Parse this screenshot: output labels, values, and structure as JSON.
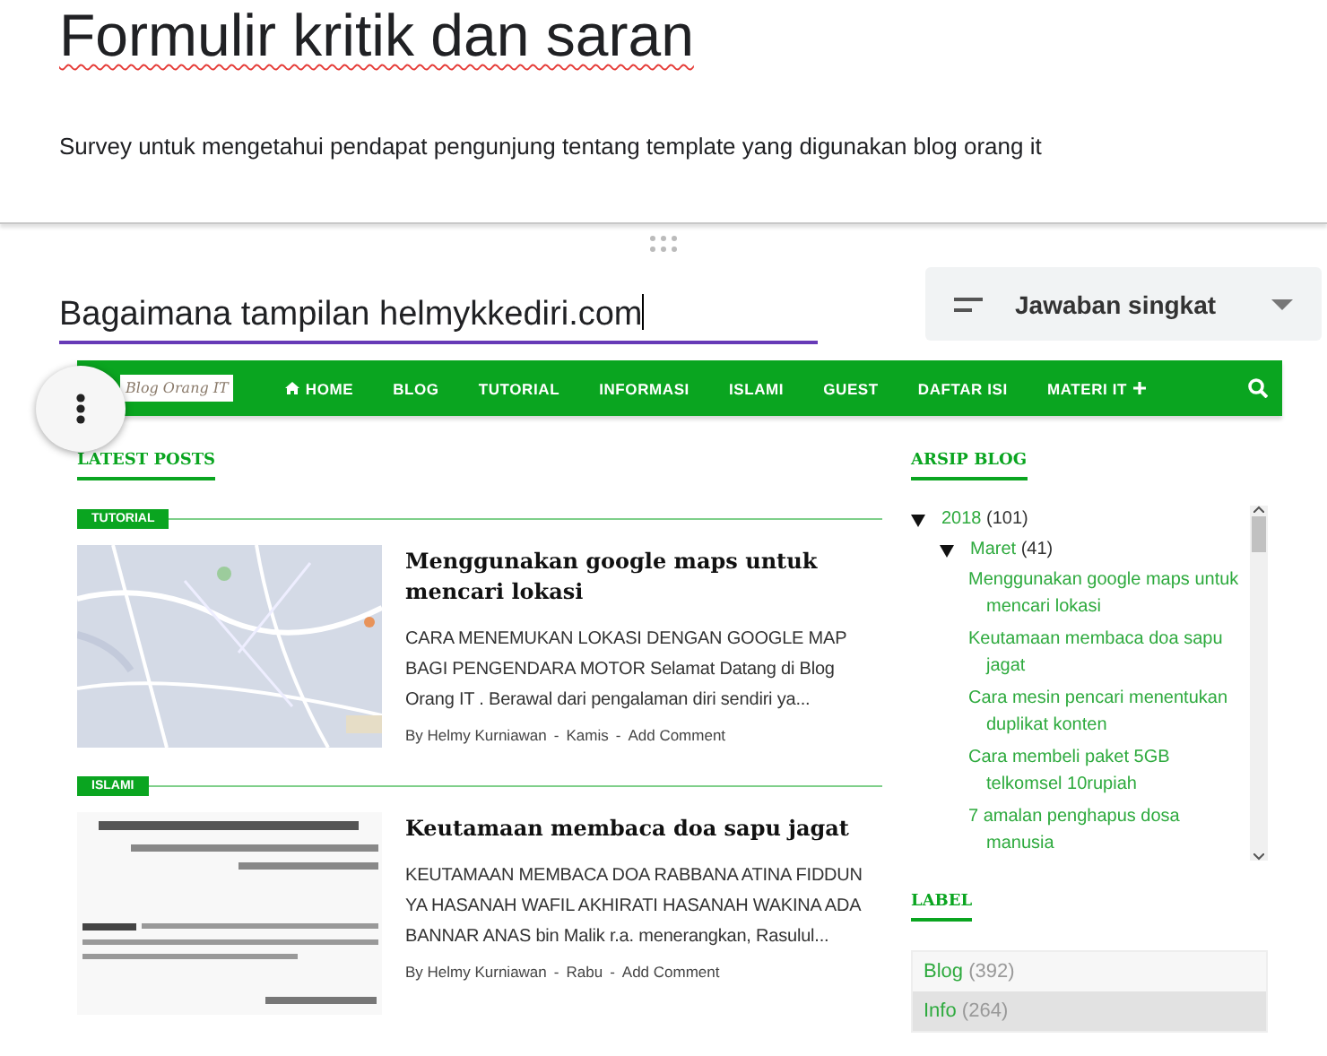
{
  "form": {
    "title": "Formulir kritik dan saran",
    "description": "Survey untuk mengetahui pendapat pengunjung tentang template yang digunakan blog orang it"
  },
  "question": {
    "title": "Bagaimana tampilan helmykkediri.com",
    "type": "Jawaban singkat"
  },
  "blog": {
    "logo": "Blog Orang IT",
    "nav": [
      {
        "label": "HOME",
        "kind": "home"
      },
      {
        "label": "BLOG",
        "kind": "plain"
      },
      {
        "label": "TUTORIAL",
        "kind": "plain"
      },
      {
        "label": "INFORMASI",
        "kind": "plain"
      },
      {
        "label": "ISLAMI",
        "kind": "plain"
      },
      {
        "label": "GUEST",
        "kind": "plain"
      },
      {
        "label": "DAFTAR ISI",
        "kind": "plain"
      },
      {
        "label": "MATERI IT",
        "kind": "more"
      }
    ],
    "latest_heading": "LATEST POSTS",
    "posts": [
      {
        "category": "TUTORIAL",
        "title": "Menggunakan google maps untuk mencari lokasi",
        "excerpt": "CARA MENEMUKAN LOKASI DENGAN GOOGLE MAP BAGI PENGENDARA MOTOR Selamat Datang di Blog Orang IT . Berawal dari pengalaman diri sendiri ya...",
        "author": "By Helmy Kurniawan",
        "day": "Kamis",
        "comments": "Add Comment",
        "separator": "-",
        "kind": "picture"
      },
      {
        "category": "ISLAMI",
        "title": "Keutamaan membaca doa sapu jagat",
        "excerpt": "KEUTAMAAN MEMBACA DOA RABBANA ATINA FIDDUN YA HASANAH WAFIL AKHIRATI HASANAH WAKINA ADA BANNAR ANAS bin Malik r.a. menerangkan, Rasulul...",
        "author": "By Helmy Kurniawan",
        "day": "Rabu",
        "comments": "Add Comment",
        "separator": "-",
        "kind": "picture"
      }
    ],
    "archive": {
      "heading": "ARSIP BLOG",
      "tree": [
        {
          "label": "2018",
          "count": "(101)",
          "expanded": true,
          "children": [
            {
              "label": "Maret",
              "count": "(41)",
              "expanded": true,
              "children": [
                {
                  "label": "Menggunakan google maps untuk mencari lokasi"
                },
                {
                  "label": "Keutamaan membaca doa sapu jagat"
                },
                {
                  "label": "Cara mesin pencari menentukan duplikat konten"
                },
                {
                  "label": "Cara membeli paket 5GB telkomsel 10rupiah"
                },
                {
                  "label": "7 amalan penghapus dosa manusia"
                }
              ]
            }
          ]
        }
      ]
    },
    "labels": {
      "heading": "LABEL",
      "items": [
        {
          "name": "Blog",
          "count": "(392)",
          "selected": false
        },
        {
          "name": "Info",
          "count": "(264)",
          "selected": true
        }
      ]
    }
  }
}
